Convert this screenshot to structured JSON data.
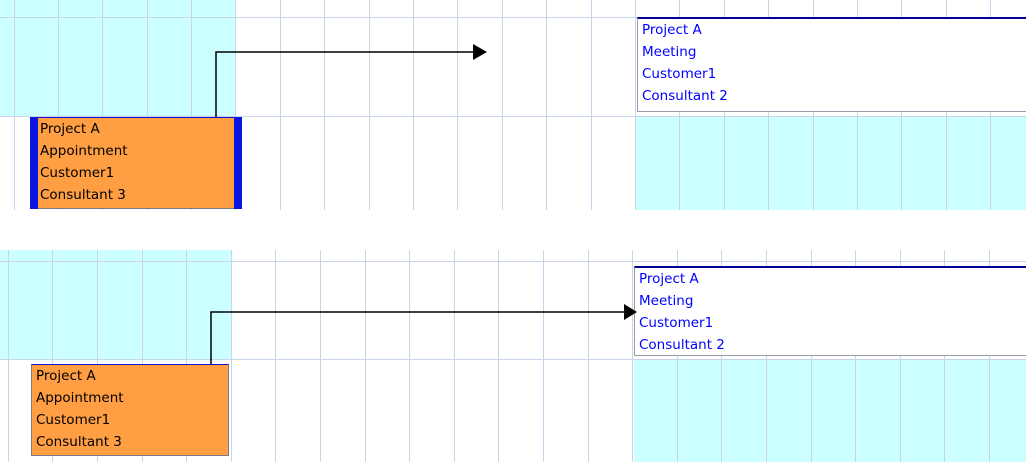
{
  "colors": {
    "grid_line": "#c9d3ea",
    "working_cell": "#ccffff",
    "off_cell": "#ffffff",
    "appointment_fill": "#ff9e42",
    "appointment_border_top": "#1010cc",
    "appointment_border_bottom": "#7a7a8a",
    "appointment_text": "#000000",
    "meeting_fill": "#ffffff",
    "meeting_text": "#0000ff",
    "meeting_border_top": "#000099",
    "meeting_border_bottom": "#9a9aa8",
    "connector": "#000000"
  },
  "scheduler_top": {
    "appointment": {
      "lines": [
        "Project A",
        "Appointment",
        "Customer1",
        "Consultant 3"
      ],
      "selected": true
    },
    "meeting": {
      "lines": [
        "Project A",
        "Meeting",
        "Customer1",
        "Consultant 2"
      ]
    }
  },
  "scheduler_bottom": {
    "appointment": {
      "lines": [
        "Project A",
        "Appointment",
        "Customer1",
        "Consultant 3"
      ],
      "selected": false
    },
    "meeting": {
      "lines": [
        "Project A",
        "Meeting",
        "Customer1",
        "Consultant 2"
      ]
    }
  }
}
